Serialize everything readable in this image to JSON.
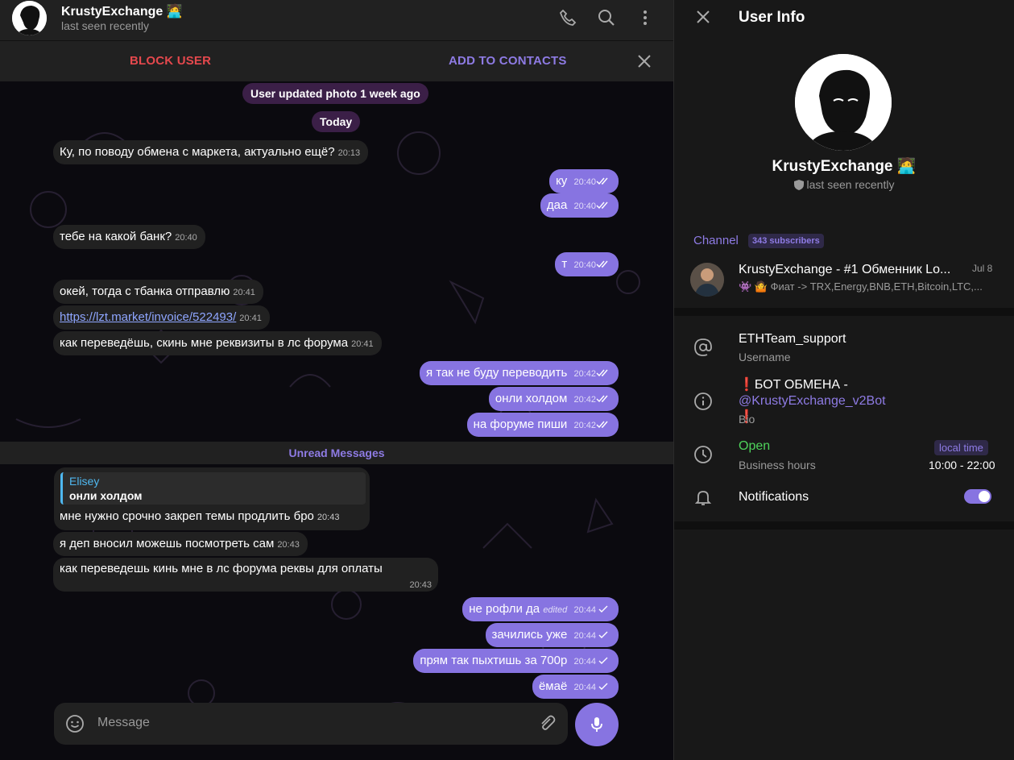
{
  "header": {
    "name": "KrustyExchange 🧑‍💻",
    "status": "last seen recently",
    "block_label": "BLOCK USER",
    "add_label": "ADD TO CONTACTS"
  },
  "messages": {
    "service_photo": "User updated photo 1 week ago",
    "date_pill": "Today",
    "m1": {
      "text": "Ку, по поводу обмена с маркета, актуально ещё?",
      "time": "20:13"
    },
    "m2": {
      "text": "ку",
      "time": "20:40"
    },
    "m3": {
      "text": "даа",
      "time": "20:40"
    },
    "m4": {
      "text": "тебе на какой банк?",
      "time": "20:40"
    },
    "m5": {
      "text": "т",
      "time": "20:40"
    },
    "m6": {
      "text": "окей, тогда с тбанка отправлю",
      "time": "20:41"
    },
    "m7": {
      "text": "https://lzt.market/invoice/522493/",
      "time": "20:41"
    },
    "m8": {
      "text": "как переведёшь, скинь мне реквизиты в лс форума",
      "time": "20:41"
    },
    "m9": {
      "text": "я так не буду переводить",
      "time": "20:42"
    },
    "m10": {
      "text": "онли холдом",
      "time": "20:42"
    },
    "m11": {
      "text": "на форуме пиши",
      "time": "20:42"
    },
    "unread": "Unread Messages",
    "reply": {
      "author": "Elisey",
      "quote": "онли холдом",
      "text": "мне нужно срочно закреп темы продлить бро",
      "time": "20:43"
    },
    "m13": {
      "text": "я деп вносил можешь посмотреть сам",
      "time": "20:43"
    },
    "m14": {
      "text": "как переведешь кинь мне в лс форума реквы для оплаты",
      "time": "20:43"
    },
    "m15": {
      "text": "не рофли да",
      "edited": "edited",
      "time": "20:44"
    },
    "m16": {
      "text": "зачились уже",
      "time": "20:44"
    },
    "m17": {
      "text": "прям так пыхтишь за 700р",
      "time": "20:44"
    },
    "m18": {
      "text": "ёмаё",
      "time": "20:44"
    }
  },
  "composer": {
    "placeholder": "Message"
  },
  "user_info": {
    "title": "User Info",
    "name": "KrustyExchange 🧑‍💻",
    "status": "last seen recently",
    "channel_label": "Channel",
    "subscribers": "343 subscribers",
    "channel_name": "KrustyExchange - #1 Обменник Lo...",
    "channel_date": "Jul 8",
    "channel_last": "👾 🤷 Фиат -> TRX,Energy,BNB,ETH,Bitcoin,LTC,...",
    "username": "ETHTeam_support",
    "username_label": "Username",
    "bio_prefix": "❗",
    "bio_text": "БОТ ОБМЕНА - ",
    "bio_mention": "@KrustyExchange_v2Bot",
    "bio_suffix": "❗",
    "bio_label": "Bio",
    "hours_status": "Open",
    "hours_badge": "local time",
    "hours_label": "Business hours",
    "hours_value": "10:00 - 22:00",
    "notifications_label": "Notifications",
    "notifications_on": true
  },
  "colors": {
    "accent": "#8774e1",
    "danger": "#e5484d",
    "open": "#4ed35b"
  }
}
